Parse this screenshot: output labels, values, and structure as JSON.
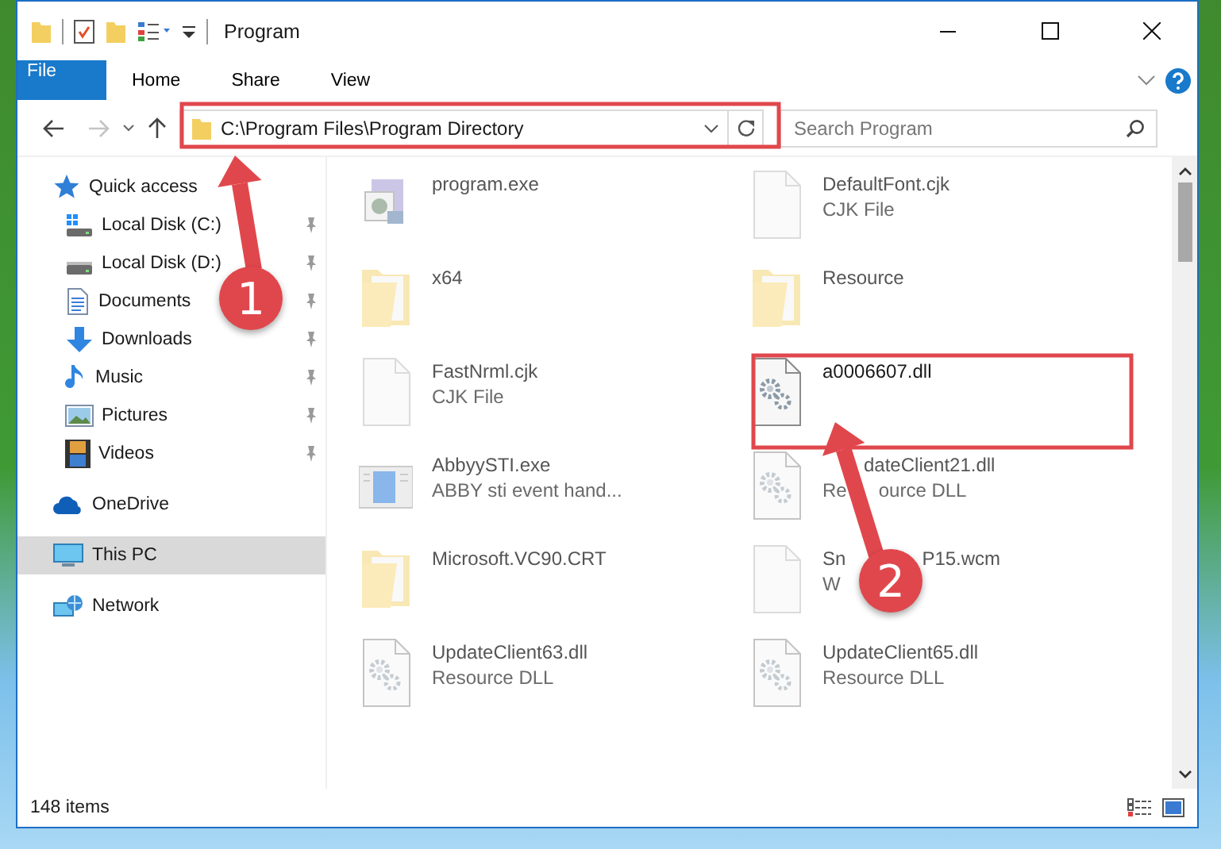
{
  "window": {
    "title": "Program"
  },
  "ribbon_tabs": [
    {
      "label": "File",
      "kind": "file",
      "selected": false
    },
    {
      "label": "Home",
      "kind": "tab",
      "selected": false
    },
    {
      "label": "Share",
      "kind": "tab",
      "selected": false
    },
    {
      "label": "View",
      "kind": "tab",
      "selected": false
    }
  ],
  "address_bar": {
    "path": "C:\\Program Files\\Program Directory"
  },
  "search": {
    "placeholder": "Search Program"
  },
  "sidebar": {
    "items": [
      {
        "label": "Quick access",
        "kind": "star",
        "selected": false,
        "children": [
          {
            "label": "Local Disk (C:)",
            "kind": "disk-c",
            "pinned": true,
            "selected": false
          },
          {
            "label": "Local Disk (D:)",
            "kind": "disk",
            "pinned": true,
            "selected": false
          },
          {
            "label": "Documents",
            "kind": "documents",
            "pinned": true,
            "selected": false
          },
          {
            "label": "Downloads",
            "kind": "downloads",
            "pinned": true,
            "selected": false
          },
          {
            "label": "Music",
            "kind": "music",
            "pinned": true,
            "selected": false
          },
          {
            "label": "Pictures",
            "kind": "pictures",
            "pinned": true,
            "selected": false
          },
          {
            "label": "Videos",
            "kind": "videos",
            "pinned": true,
            "selected": false
          }
        ]
      },
      {
        "label": "OneDrive",
        "kind": "cloud",
        "selected": false
      },
      {
        "label": "This PC",
        "kind": "pc",
        "selected": true
      },
      {
        "label": "Network",
        "kind": "network",
        "selected": false
      }
    ]
  },
  "files": [
    {
      "name": "program.exe",
      "kind": "exe",
      "dimmed": true
    },
    {
      "name": "DefaultFont.cjk",
      "type": "CJK File",
      "kind": "page",
      "dimmed": true
    },
    {
      "name": "x64",
      "kind": "folder",
      "dimmed": true
    },
    {
      "name": "Resource",
      "kind": "folder",
      "dimmed": true
    },
    {
      "name": "FastNrml.cjk",
      "type": "CJK File",
      "kind": "page",
      "dimmed": true
    },
    {
      "name": "a0006607.dll",
      "kind": "dll",
      "dimmed": false
    },
    {
      "name": "AbbyySTI.exe",
      "type": "ABBY sti event hand...",
      "kind": "app",
      "dimmed": true
    },
    {
      "name": "dateClient21.dll",
      "type_start": "Re",
      "type": "ource DLL",
      "kind": "dll",
      "dimmed": true
    },
    {
      "name": "Microsoft.VC90.CRT",
      "kind": "folder",
      "dimmed": true
    },
    {
      "name_start": "Sn",
      "name": "P15.wcm",
      "type": "W",
      "kind": "page",
      "dimmed": true
    },
    {
      "name": "UpdateClient63.dll",
      "type": "Resource DLL",
      "kind": "dll",
      "dimmed": true
    },
    {
      "name": "UpdateClient65.dll",
      "type": "Resource DLL",
      "kind": "dll",
      "dimmed": true
    }
  ],
  "status_bar": {
    "item_count": "148 items"
  },
  "annotations": [
    {
      "label": "1"
    },
    {
      "label": "2"
    }
  ]
}
